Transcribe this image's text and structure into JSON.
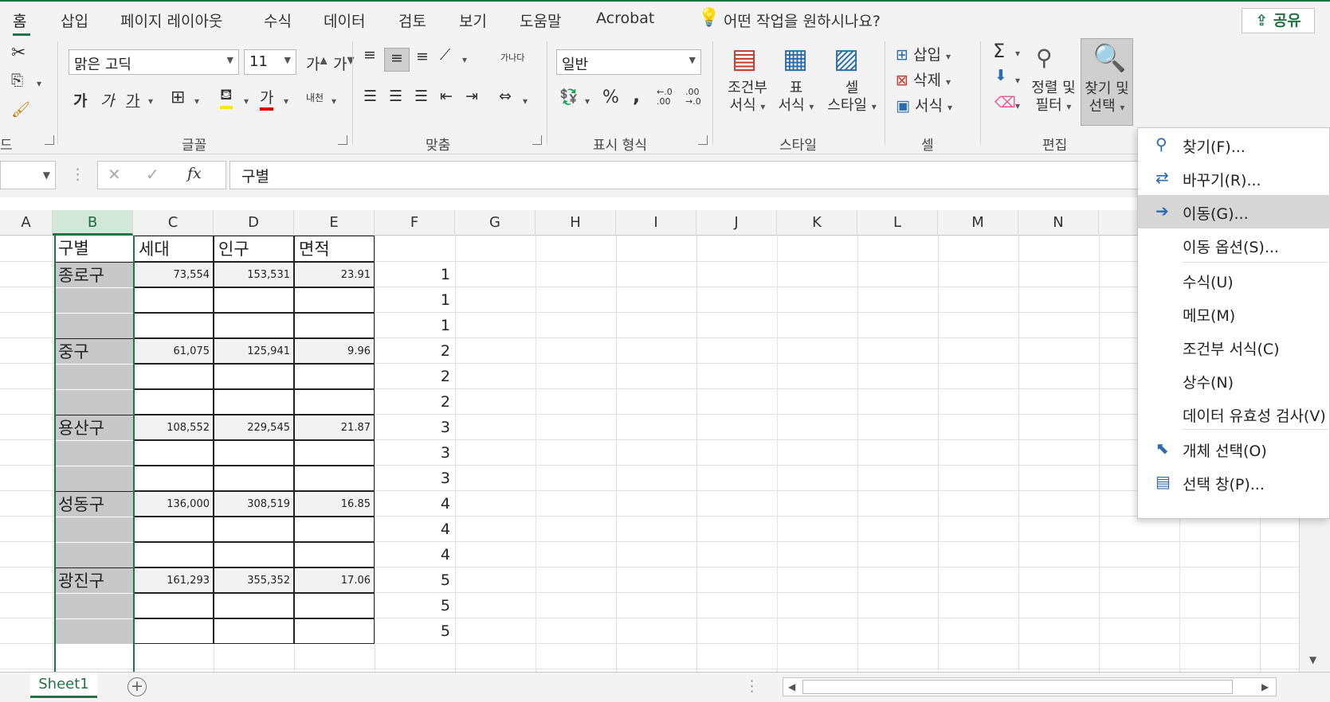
{
  "tabs": [
    "홈",
    "삽입",
    "페이지 레이아웃",
    "수식",
    "데이터",
    "검토",
    "보기",
    "도움말",
    "Acrobat"
  ],
  "tell_me": "어떤 작업을 원하시나요?",
  "share": "공유",
  "ribbon": {
    "clipboard_label": "드",
    "font_name": "맑은 고딕",
    "font_size": "11",
    "grow_font": "가",
    "shrink_font": "가",
    "bold": "가",
    "italic": "가",
    "underline": "가",
    "font_color_glyph": "가",
    "phonetic": "내천",
    "font_group_label": "글꼴",
    "wrap_glyph": "가나다",
    "align_group_label": "맞춤",
    "number_format": "일반",
    "percent": "%",
    "comma": ",",
    "inc_decimal": "←.0 .00",
    "dec_decimal": ".00 →.0",
    "number_group_label": "표시 형식",
    "conditional_format": [
      "조건부",
      "서식"
    ],
    "format_table": [
      "표",
      "서식"
    ],
    "cell_style": [
      "셀",
      "스타일"
    ],
    "style_group_label": "스타일",
    "insert": "삽입",
    "delete": "삭제",
    "format": "서식",
    "cells_group_label": "셀",
    "sum_glyph": "Σ",
    "sort_filter": [
      "정렬 및",
      "필터"
    ],
    "find_select": [
      "찾기 및",
      "선택"
    ],
    "edit_group_label": "편집"
  },
  "formula_bar": {
    "fx": "fx",
    "content": "구별"
  },
  "columns": [
    "A",
    "B",
    "C",
    "D",
    "E",
    "F",
    "G",
    "H",
    "I",
    "J",
    "K",
    "L",
    "M",
    "N"
  ],
  "header_row": [
    "구별",
    "세대",
    "인구",
    "면적"
  ],
  "districts": [
    {
      "name": "종로구",
      "households": "73,554",
      "population": "153,531",
      "area": "23.91"
    },
    {
      "name": "중구",
      "households": "61,075",
      "population": "125,941",
      "area": "9.96"
    },
    {
      "name": "용산구",
      "households": "108,552",
      "population": "229,545",
      "area": "21.87"
    },
    {
      "name": "성동구",
      "households": "136,000",
      "population": "308,519",
      "area": "16.85"
    },
    {
      "name": "광진구",
      "households": "161,293",
      "population": "355,352",
      "area": "17.06"
    }
  ],
  "f_values": [
    "1",
    "1",
    "1",
    "2",
    "2",
    "2",
    "3",
    "3",
    "3",
    "4",
    "4",
    "4",
    "5",
    "5",
    "5"
  ],
  "sheet_tab": "Sheet1",
  "menu": [
    {
      "label": "찾기(F)...",
      "icon": "search-icon"
    },
    {
      "label": "바꾸기(R)...",
      "icon": "replace-icon"
    },
    {
      "label": "이동(G)...",
      "icon": "arrow-right-icon"
    },
    {
      "label": "이동 옵션(S)...",
      "icon": ""
    },
    {
      "label": "수식(U)",
      "icon": ""
    },
    {
      "label": "메모(M)",
      "icon": ""
    },
    {
      "label": "조건부 서식(C)",
      "icon": ""
    },
    {
      "label": "상수(N)",
      "icon": ""
    },
    {
      "label": "데이터 유효성 검사(V)",
      "icon": ""
    },
    {
      "label": "개체 선택(O)",
      "icon": "cursor-icon"
    },
    {
      "label": "선택 창(P)...",
      "icon": "selection-pane-icon"
    }
  ]
}
